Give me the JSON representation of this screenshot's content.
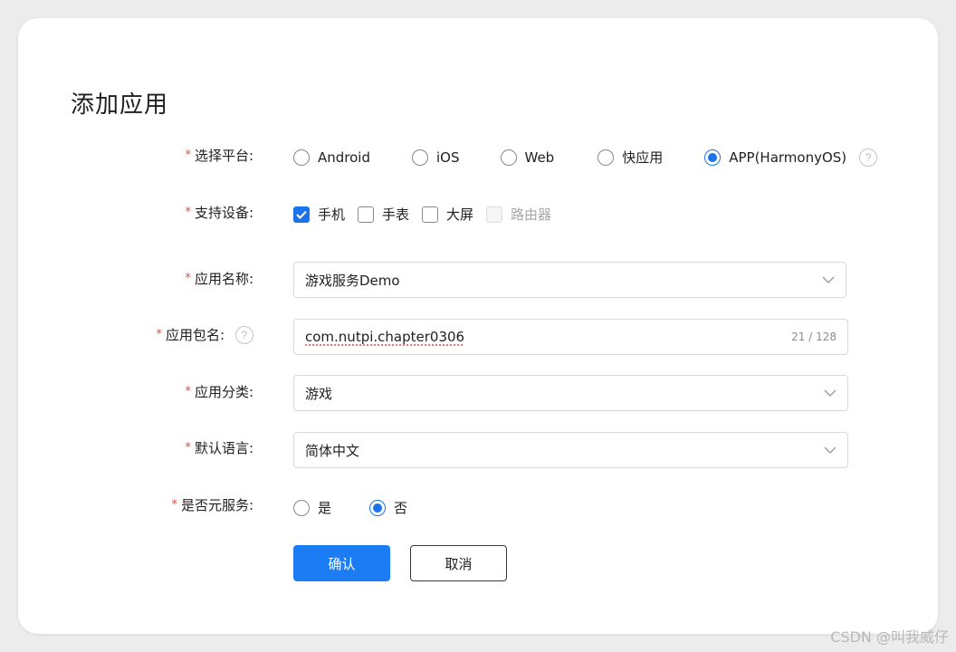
{
  "dialog": {
    "title": "添加应用"
  },
  "required_mark": "*",
  "platform": {
    "label": "选择平台:",
    "options": [
      "Android",
      "iOS",
      "Web",
      "快应用",
      "APP(HarmonyOS)"
    ],
    "selected": "APP(HarmonyOS)",
    "help": "?"
  },
  "devices": {
    "label": "支持设备:",
    "options": [
      {
        "label": "手机",
        "checked": true,
        "disabled": false
      },
      {
        "label": "手表",
        "checked": false,
        "disabled": false
      },
      {
        "label": "大屏",
        "checked": false,
        "disabled": false
      },
      {
        "label": "路由器",
        "checked": false,
        "disabled": true
      }
    ]
  },
  "app_name": {
    "label": "应用名称:",
    "value": "游戏服务Demo"
  },
  "package_name": {
    "label": "应用包名:",
    "help": "?",
    "value": "com.nutpi.chapter0306",
    "counter": "21 / 128"
  },
  "category": {
    "label": "应用分类:",
    "value": "游戏"
  },
  "language": {
    "label": "默认语言:",
    "value": "简体中文"
  },
  "meta_service": {
    "label": "是否元服务:",
    "options": [
      "是",
      "否"
    ],
    "selected": "否"
  },
  "buttons": {
    "confirm": "确认",
    "cancel": "取消"
  },
  "watermark": "CSDN @叫我威仔",
  "colors": {
    "accent": "#1a73e8",
    "primary_button": "#1c7cf4",
    "required": "#e8473c"
  }
}
